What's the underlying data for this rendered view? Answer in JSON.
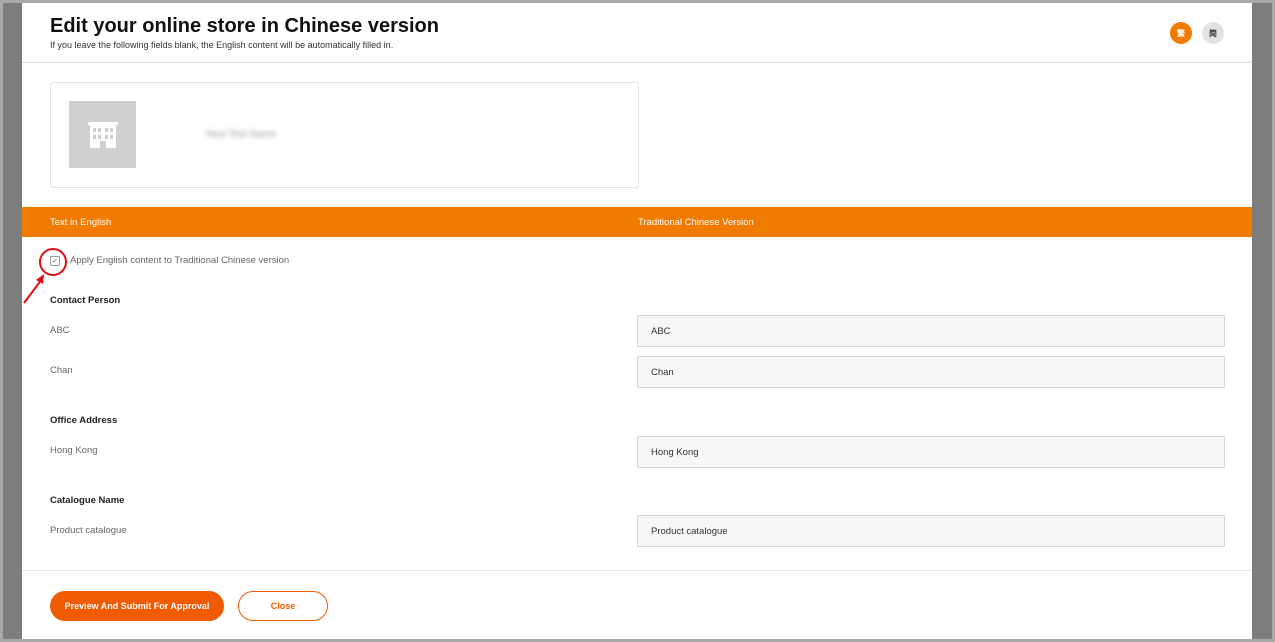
{
  "header": {
    "title": "Edit your online store in Chinese version",
    "subtitle": "If you leave the following fields blank, the English content will be automatically filled in.",
    "lang_active": "繁",
    "lang_inactive": "简"
  },
  "store": {
    "name": "New Test Name"
  },
  "table_header": {
    "left": "Text in English",
    "right": "Traditional Chinese Version"
  },
  "apply": {
    "checked": true,
    "check_glyph": "✓",
    "label": "Apply English content to Traditional Chinese version"
  },
  "sections": {
    "contact": {
      "title": "Contact Person",
      "first_en": "ABC",
      "first_zh": "ABC",
      "last_en": "Chan",
      "last_zh": "Chan"
    },
    "address": {
      "title": "Office Address",
      "en": "Hong Kong",
      "zh": "Hong Kong"
    },
    "catalogue": {
      "title": "Catalogue Name",
      "en": "Product catalogue",
      "zh": "Product catalogue"
    }
  },
  "footer": {
    "submit_label": "Preview And Submit For Approval",
    "close_label": "Close"
  },
  "colors": {
    "accent": "#f07b00",
    "button": "#f05a00",
    "annotation": "#e0101a"
  }
}
